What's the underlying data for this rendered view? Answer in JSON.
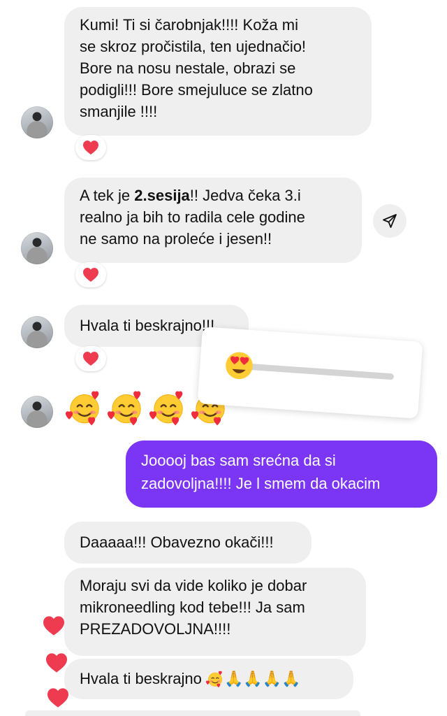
{
  "chat": {
    "messages": [
      {
        "lines": [
          "Kumi! Ti si čarobnjak!!!! Koža mi",
          "se skroz pročistila, ten ujednačio!",
          "Bore na nosu nestale, obrazi se",
          "podigli!!! Bore smejuluce se zlatno",
          "smanjile !!!!"
        ],
        "reaction": "❤️"
      },
      {
        "l1_pre": "A tek je ",
        "l1_bold": "2.sesija",
        "l1_post": "!! Jedva čeka 3.i",
        "l2": "realno ja bih to radila cele godine",
        "l3": "ne samo na proleće i jesen!!",
        "reaction": "❤️"
      },
      {
        "text": "Hvala ti beskrajno!!!",
        "reaction": "❤️"
      },
      {
        "emoji": [
          "smiling-face-with-hearts",
          "smiling-face-with-hearts",
          "smiling-face-with-hearts",
          "smiling-face-with-hearts"
        ]
      },
      {
        "lines": [
          "Jooooj bas sam srećna da si",
          "zadovoljna!!!! Je l smem da okacim"
        ]
      },
      {
        "text": "Daaaaa!!! Obavezno okači!!!"
      },
      {
        "lines": [
          "Moraju svi da vide koliko je dobar",
          "mikroneedling kod tebe!!! Ja sam",
          "PREZADOVOLJNA!!!!"
        ]
      },
      {
        "text": "Hvala ti beskrajno",
        "emoji": "smiling-face-with-hearts",
        "hands": "🙏🙏🙏🙏"
      }
    ]
  },
  "slider": {
    "emoji": "heart-eyes",
    "level": 0.0
  },
  "icons": {
    "share": "paper-plane-icon",
    "reaction": "heart-icon"
  },
  "colors": {
    "outgoing_bubble": "#7b35f5",
    "incoming_bubble": "#efefef",
    "heart": "#ee3b50"
  }
}
